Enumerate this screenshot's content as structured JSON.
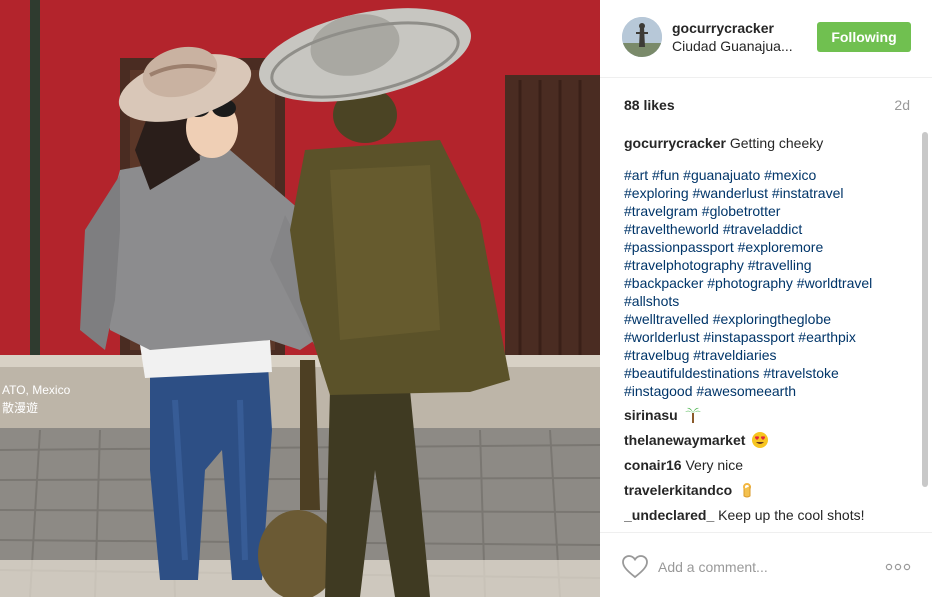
{
  "post": {
    "photo_watermark_line1": "ATO, Mexico",
    "photo_watermark_line2": "散漫遊"
  },
  "header": {
    "username": "gocurrycracker",
    "location": "Ciudad Guanajua...",
    "follow_label": "Following"
  },
  "stats": {
    "likes": "88 likes",
    "time": "2d"
  },
  "caption": {
    "username": "gocurrycracker",
    "text": "Getting cheeky",
    "hashtags": [
      "#art #fun #guanajuato #mexico",
      "#exploring #wanderlust #instatravel",
      "#travelgram #globetrotter",
      "#traveltheworld #traveladdict",
      "#passionpassport #exploremore",
      "#travelphotography #travelling",
      "#backpacker #photography #worldtravel",
      "#allshots",
      "#welltravelled #exploringtheglobe",
      "#worlderlust #instapassport #earthpix",
      "#travelbug #traveldiaries",
      "#beautifuldestinations #travelstoke",
      "#instagood #awesomeearth"
    ]
  },
  "comments": [
    {
      "username": "sirinasu",
      "text": "",
      "emoji": "palm-tree-icon"
    },
    {
      "username": "thelanewaymarket",
      "text": "",
      "emoji": "heart-eyes-icon"
    },
    {
      "username": "conair16",
      "text": "Very nice",
      "emoji": ""
    },
    {
      "username": "travelerkitandco",
      "text": "",
      "emoji": "ok-hand-icon"
    },
    {
      "username": "_undeclared_",
      "text": "Keep up the cool shots!",
      "emoji": ""
    }
  ],
  "footer": {
    "comment_placeholder": "Add a comment...",
    "like_icon": "heart-outline-icon",
    "more_icon": "more-options-icon"
  },
  "colors": {
    "follow_button": "#70c050",
    "hashtag": "#003569",
    "secondary_text": "#999999"
  }
}
